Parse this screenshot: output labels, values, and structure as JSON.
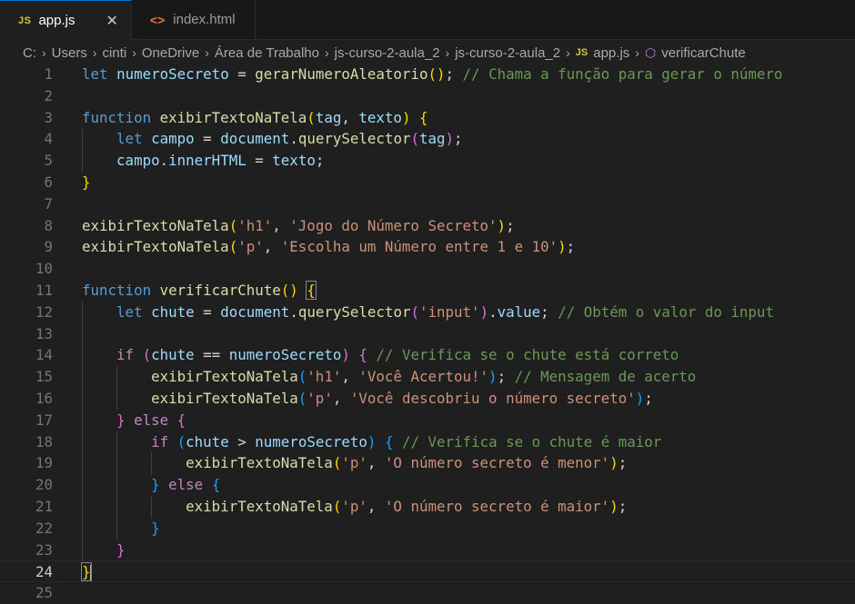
{
  "tabs": [
    {
      "icon": "JS",
      "label": "app.js",
      "active": true,
      "close": "✕"
    },
    {
      "icon": "<>",
      "label": "index.html",
      "active": false
    }
  ],
  "breadcrumb": [
    "C:",
    "Users",
    "cinti",
    "OneDrive",
    "Área de Trabalho",
    "js-curso-2-aula_2",
    "js-curso-2-aula_2",
    "app.js",
    "verificarChute"
  ],
  "editor": {
    "current_line": 24,
    "lines": [
      [
        {
          "t": "let",
          "c": "kw"
        },
        {
          "t": " ",
          "c": "pl"
        },
        {
          "t": "numeroSecreto",
          "c": "var"
        },
        {
          "t": " = ",
          "c": "pl"
        },
        {
          "t": "gerarNumeroAleatorio",
          "c": "fn"
        },
        {
          "t": "()",
          "c": "b1"
        },
        {
          "t": "; ",
          "c": "pl"
        },
        {
          "t": "// Chama a função para gerar o número",
          "c": "cm"
        }
      ],
      [],
      [
        {
          "t": "function",
          "c": "kw"
        },
        {
          "t": " ",
          "c": "pl"
        },
        {
          "t": "exibirTextoNaTela",
          "c": "fn"
        },
        {
          "t": "(",
          "c": "b1"
        },
        {
          "t": "tag",
          "c": "var"
        },
        {
          "t": ", ",
          "c": "pl"
        },
        {
          "t": "texto",
          "c": "var"
        },
        {
          "t": ")",
          "c": "b1"
        },
        {
          "t": " ",
          "c": "pl"
        },
        {
          "t": "{",
          "c": "b1"
        }
      ],
      [
        {
          "t": "    ",
          "c": "pl"
        },
        {
          "t": "let",
          "c": "kw"
        },
        {
          "t": " ",
          "c": "pl"
        },
        {
          "t": "campo",
          "c": "var"
        },
        {
          "t": " = ",
          "c": "pl"
        },
        {
          "t": "document",
          "c": "var"
        },
        {
          "t": ".",
          "c": "pl"
        },
        {
          "t": "querySelector",
          "c": "fn"
        },
        {
          "t": "(",
          "c": "b2"
        },
        {
          "t": "tag",
          "c": "var"
        },
        {
          "t": ")",
          "c": "b2"
        },
        {
          "t": ";",
          "c": "pl"
        }
      ],
      [
        {
          "t": "    ",
          "c": "pl"
        },
        {
          "t": "campo",
          "c": "var"
        },
        {
          "t": ".",
          "c": "pl"
        },
        {
          "t": "innerHTML",
          "c": "var"
        },
        {
          "t": " = ",
          "c": "pl"
        },
        {
          "t": "texto",
          "c": "var"
        },
        {
          "t": ";",
          "c": "pl"
        }
      ],
      [
        {
          "t": "}",
          "c": "b1"
        }
      ],
      [],
      [
        {
          "t": "exibirTextoNaTela",
          "c": "fn"
        },
        {
          "t": "(",
          "c": "b1"
        },
        {
          "t": "'h1'",
          "c": "str"
        },
        {
          "t": ", ",
          "c": "pl"
        },
        {
          "t": "'Jogo do Número Secreto'",
          "c": "str"
        },
        {
          "t": ")",
          "c": "b1"
        },
        {
          "t": ";",
          "c": "pl"
        }
      ],
      [
        {
          "t": "exibirTextoNaTela",
          "c": "fn"
        },
        {
          "t": "(",
          "c": "b1"
        },
        {
          "t": "'p'",
          "c": "str"
        },
        {
          "t": ", ",
          "c": "pl"
        },
        {
          "t": "'Escolha um Número entre 1 e 10'",
          "c": "str"
        },
        {
          "t": ")",
          "c": "b1"
        },
        {
          "t": ";",
          "c": "pl"
        }
      ],
      [],
      [
        {
          "t": "function",
          "c": "kw"
        },
        {
          "t": " ",
          "c": "pl"
        },
        {
          "t": "verificarChute",
          "c": "fn"
        },
        {
          "t": "()",
          "c": "b1"
        },
        {
          "t": " ",
          "c": "pl"
        },
        {
          "t": "{",
          "c": "b1 bm"
        }
      ],
      [
        {
          "t": "    ",
          "c": "pl"
        },
        {
          "t": "let",
          "c": "kw"
        },
        {
          "t": " ",
          "c": "pl"
        },
        {
          "t": "chute",
          "c": "var"
        },
        {
          "t": " = ",
          "c": "pl"
        },
        {
          "t": "document",
          "c": "var"
        },
        {
          "t": ".",
          "c": "pl"
        },
        {
          "t": "querySelector",
          "c": "fn"
        },
        {
          "t": "(",
          "c": "b2"
        },
        {
          "t": "'input'",
          "c": "str"
        },
        {
          "t": ")",
          "c": "b2"
        },
        {
          "t": ".",
          "c": "pl"
        },
        {
          "t": "value",
          "c": "var"
        },
        {
          "t": "; ",
          "c": "pl"
        },
        {
          "t": "// Obtém o valor do input",
          "c": "cm"
        }
      ],
      [],
      [
        {
          "t": "    ",
          "c": "pl"
        },
        {
          "t": "if",
          "c": "ctl"
        },
        {
          "t": " ",
          "c": "pl"
        },
        {
          "t": "(",
          "c": "b2"
        },
        {
          "t": "chute",
          "c": "var"
        },
        {
          "t": " == ",
          "c": "pl"
        },
        {
          "t": "numeroSecreto",
          "c": "var"
        },
        {
          "t": ")",
          "c": "b2"
        },
        {
          "t": " ",
          "c": "pl"
        },
        {
          "t": "{",
          "c": "b2"
        },
        {
          "t": " ",
          "c": "pl"
        },
        {
          "t": "// Verifica se o chute está correto",
          "c": "cm"
        }
      ],
      [
        {
          "t": "        ",
          "c": "pl"
        },
        {
          "t": "exibirTextoNaTela",
          "c": "fn"
        },
        {
          "t": "(",
          "c": "b3"
        },
        {
          "t": "'h1'",
          "c": "str"
        },
        {
          "t": ", ",
          "c": "pl"
        },
        {
          "t": "'Você Acertou!'",
          "c": "str"
        },
        {
          "t": ")",
          "c": "b3"
        },
        {
          "t": "; ",
          "c": "pl"
        },
        {
          "t": "// Mensagem de acerto",
          "c": "cm"
        }
      ],
      [
        {
          "t": "        ",
          "c": "pl"
        },
        {
          "t": "exibirTextoNaTela",
          "c": "fn"
        },
        {
          "t": "(",
          "c": "b3"
        },
        {
          "t": "'p'",
          "c": "str"
        },
        {
          "t": ", ",
          "c": "pl"
        },
        {
          "t": "'Você descobriu o número secreto'",
          "c": "str"
        },
        {
          "t": ")",
          "c": "b3"
        },
        {
          "t": ";",
          "c": "pl"
        }
      ],
      [
        {
          "t": "    ",
          "c": "pl"
        },
        {
          "t": "}",
          "c": "b2"
        },
        {
          "t": " ",
          "c": "pl"
        },
        {
          "t": "else",
          "c": "ctl"
        },
        {
          "t": " ",
          "c": "pl"
        },
        {
          "t": "{",
          "c": "b2"
        }
      ],
      [
        {
          "t": "        ",
          "c": "pl"
        },
        {
          "t": "if",
          "c": "ctl"
        },
        {
          "t": " ",
          "c": "pl"
        },
        {
          "t": "(",
          "c": "b3"
        },
        {
          "t": "chute",
          "c": "var"
        },
        {
          "t": " > ",
          "c": "pl"
        },
        {
          "t": "numeroSecreto",
          "c": "var"
        },
        {
          "t": ")",
          "c": "b3"
        },
        {
          "t": " ",
          "c": "pl"
        },
        {
          "t": "{",
          "c": "b3"
        },
        {
          "t": " ",
          "c": "pl"
        },
        {
          "t": "// Verifica se o chute é maior",
          "c": "cm"
        }
      ],
      [
        {
          "t": "            ",
          "c": "pl"
        },
        {
          "t": "exibirTextoNaTela",
          "c": "fn"
        },
        {
          "t": "(",
          "c": "b1"
        },
        {
          "t": "'p'",
          "c": "str"
        },
        {
          "t": ", ",
          "c": "pl"
        },
        {
          "t": "'O número secreto é menor'",
          "c": "str"
        },
        {
          "t": ")",
          "c": "b1"
        },
        {
          "t": ";",
          "c": "pl"
        }
      ],
      [
        {
          "t": "        ",
          "c": "pl"
        },
        {
          "t": "}",
          "c": "b3"
        },
        {
          "t": " ",
          "c": "pl"
        },
        {
          "t": "else",
          "c": "ctl"
        },
        {
          "t": " ",
          "c": "pl"
        },
        {
          "t": "{",
          "c": "b3"
        }
      ],
      [
        {
          "t": "            ",
          "c": "pl"
        },
        {
          "t": "exibirTextoNaTela",
          "c": "fn"
        },
        {
          "t": "(",
          "c": "b1"
        },
        {
          "t": "'p'",
          "c": "str"
        },
        {
          "t": ", ",
          "c": "pl"
        },
        {
          "t": "'O número secreto é maior'",
          "c": "str"
        },
        {
          "t": ")",
          "c": "b1"
        },
        {
          "t": ";",
          "c": "pl"
        }
      ],
      [
        {
          "t": "        ",
          "c": "pl"
        },
        {
          "t": "}",
          "c": "b3"
        }
      ],
      [
        {
          "t": "    ",
          "c": "pl"
        },
        {
          "t": "}",
          "c": "b2"
        }
      ],
      [
        {
          "t": "}",
          "c": "b1 bm"
        }
      ],
      []
    ]
  }
}
